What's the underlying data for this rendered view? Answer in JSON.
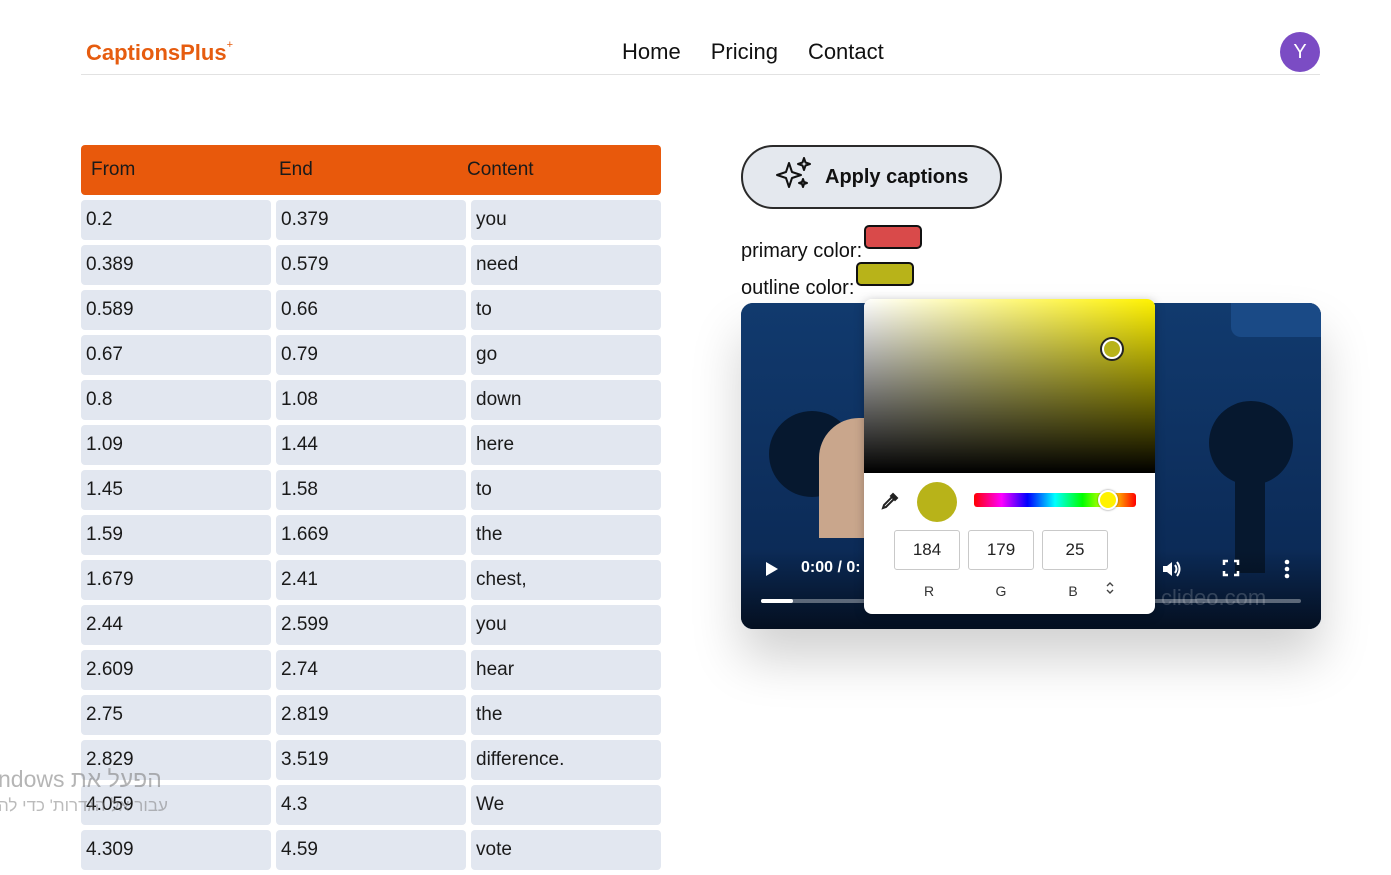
{
  "header": {
    "logo": "CaptionsPlus",
    "logo_sup": "+",
    "nav": [
      "Home",
      "Pricing",
      "Contact"
    ],
    "avatar_initial": "Y"
  },
  "table": {
    "columns": [
      "From",
      "End",
      "Content"
    ],
    "rows": [
      [
        "0.2",
        "0.379",
        "you"
      ],
      [
        "0.389",
        "0.579",
        "need"
      ],
      [
        "0.589",
        "0.66",
        "to"
      ],
      [
        "0.67",
        "0.79",
        "go"
      ],
      [
        "0.8",
        "1.08",
        "down"
      ],
      [
        "1.09",
        "1.44",
        "here"
      ],
      [
        "1.45",
        "1.58",
        "to"
      ],
      [
        "1.59",
        "1.669",
        "the"
      ],
      [
        "1.679",
        "2.41",
        "chest,"
      ],
      [
        "2.44",
        "2.599",
        "you"
      ],
      [
        "2.609",
        "2.74",
        "hear"
      ],
      [
        "2.75",
        "2.819",
        "the"
      ],
      [
        "2.829",
        "3.519",
        "difference."
      ],
      [
        "4.059",
        "4.3",
        "We"
      ],
      [
        "4.309",
        "4.59",
        "vote"
      ]
    ]
  },
  "controls": {
    "apply_label": "Apply captions",
    "primary_label": "primary color:",
    "outline_label": "outline color:",
    "primary_color": "#d94a4a",
    "outline_color": "#b8b319"
  },
  "video": {
    "time": "0:00 / 0:",
    "watermark": "clideo.com",
    "progress": 0.06
  },
  "picker": {
    "r": "184",
    "g": "179",
    "b": "25",
    "labels": [
      "R",
      "G",
      "B"
    ]
  },
  "os_overlay": {
    "line1": "ndows הפעל את",
    "line2": "עבור אל הגדרות' כדי לה"
  }
}
